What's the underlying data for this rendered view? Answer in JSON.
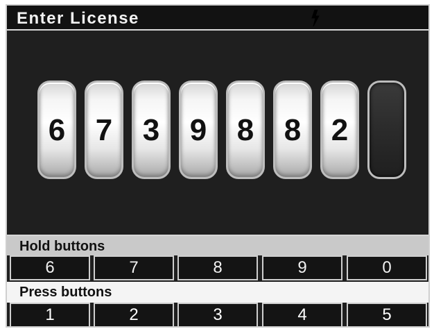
{
  "header": {
    "title": "Enter License"
  },
  "license": {
    "digits": [
      "6",
      "7",
      "3",
      "9",
      "8",
      "8",
      "2",
      ""
    ]
  },
  "hold": {
    "label": "Hold buttons",
    "buttons": [
      "6",
      "7",
      "8",
      "9",
      "0"
    ]
  },
  "press": {
    "label": "Press buttons",
    "buttons": [
      "1",
      "2",
      "3",
      "4",
      "5"
    ]
  },
  "icons": {
    "status": "lightning-icon"
  },
  "colors": {
    "background": "#1f1f1f",
    "cell": "#ffffff",
    "empty_cell": "#2b2b2b",
    "hold_bar": "#c9c9c9",
    "press_bar": "#f4f4f4"
  }
}
